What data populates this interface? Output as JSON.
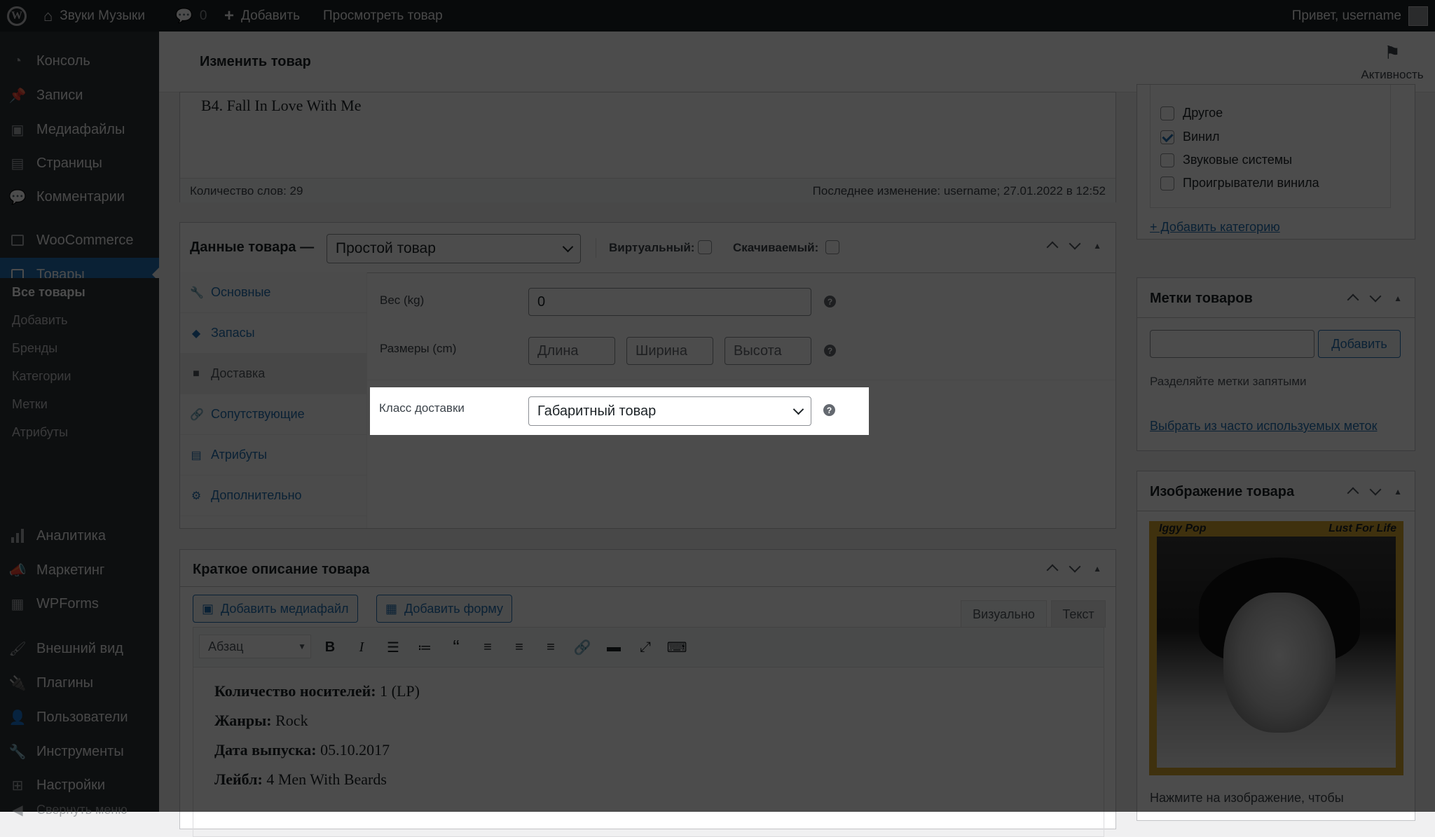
{
  "adminbar": {
    "site_name": "Звуки Музыки",
    "comments_count": "0",
    "add_new": "Добавить",
    "view_product": "Просмотреть товар",
    "greeting": "Привет, username"
  },
  "sidebar": {
    "items": [
      {
        "label": "Консоль",
        "icon": "dashboard-icon"
      },
      {
        "label": "Записи",
        "icon": "pin-icon"
      },
      {
        "label": "Медиафайлы",
        "icon": "media-icon"
      },
      {
        "label": "Страницы",
        "icon": "pages-icon"
      },
      {
        "label": "Комментарии",
        "icon": "comment-icon"
      },
      {
        "label": "WooCommerce",
        "icon": "woocommerce-icon"
      },
      {
        "label": "Товары",
        "icon": "products-icon"
      },
      {
        "label": "Аналитика",
        "icon": "analytics-icon"
      },
      {
        "label": "Маркетинг",
        "icon": "megaphone-icon"
      },
      {
        "label": "WPForms",
        "icon": "forms-icon"
      },
      {
        "label": "Внешний вид",
        "icon": "brush-icon"
      },
      {
        "label": "Плагины",
        "icon": "plugin-icon"
      },
      {
        "label": "Пользователи",
        "icon": "user-icon"
      },
      {
        "label": "Инструменты",
        "icon": "wrench-icon"
      },
      {
        "label": "Настройки",
        "icon": "settings-icon"
      },
      {
        "label": "Свернуть меню",
        "icon": "collapse-icon"
      }
    ],
    "submenu": [
      "Все товары",
      "Добавить",
      "Бренды",
      "Категории",
      "Метки",
      "Атрибуты"
    ]
  },
  "header": {
    "title": "Изменить товар",
    "activity": "Активность"
  },
  "editor": {
    "last_line": "B4. Fall In Love With Me",
    "word_count": "Количество слов: 29",
    "last_edit": "Последнее изменение: username; 27.01.2022 в 12:52"
  },
  "product_data": {
    "title": "Данные товара —",
    "type": "Простой товар",
    "virtual_label": "Виртуальный:",
    "downloadable_label": "Скачиваемый:",
    "tabs": [
      "Основные",
      "Запасы",
      "Доставка",
      "Сопутствующие",
      "Атрибуты",
      "Дополнительно"
    ],
    "weight_label": "Вес (kg)",
    "weight_value": "0",
    "dimensions_label": "Размеры (cm)",
    "length_placeholder": "Длина",
    "width_placeholder": "Ширина",
    "height_placeholder": "Высота",
    "shipping_class_label": "Класс доставки",
    "shipping_class_value": "Габаритный товар"
  },
  "short_description": {
    "title": "Краткое описание товара",
    "add_media": "Добавить медиафайл",
    "add_form": "Добавить форму",
    "tab_visual": "Визуально",
    "tab_text": "Текст",
    "format": "Абзац",
    "lines": [
      {
        "key": "Количество носителей:",
        "value": " 1 (LP)"
      },
      {
        "key": "Жанры:",
        "value": " Rock"
      },
      {
        "key": "Дата выпуска:",
        "value": " 05.10.2017"
      },
      {
        "key": "Лейбл:",
        "value": " 4 Men With Beards"
      }
    ]
  },
  "categories": {
    "items": [
      {
        "label": "Другое",
        "checked": false
      },
      {
        "label": "Винил",
        "checked": true
      },
      {
        "label": "Звуковые системы",
        "checked": false
      },
      {
        "label": "Проигрыватели винила",
        "checked": false
      }
    ],
    "add_link": "+ Добавить категорию"
  },
  "tags": {
    "title": "Метки товаров",
    "add_button": "Добавить",
    "hint": "Разделяйте метки запятыми",
    "choose_link": "Выбрать из часто используемых меток"
  },
  "product_image": {
    "title": "Изображение товара",
    "caption_left": "Iggy Pop",
    "caption_right": "Lust For Life",
    "hint": "Нажмите на изображение, чтобы"
  },
  "colors": {
    "accent": "#2271b1",
    "adminbar": "#1d2327",
    "sidebar": "#2c3338",
    "album_border": "#d4a431"
  }
}
